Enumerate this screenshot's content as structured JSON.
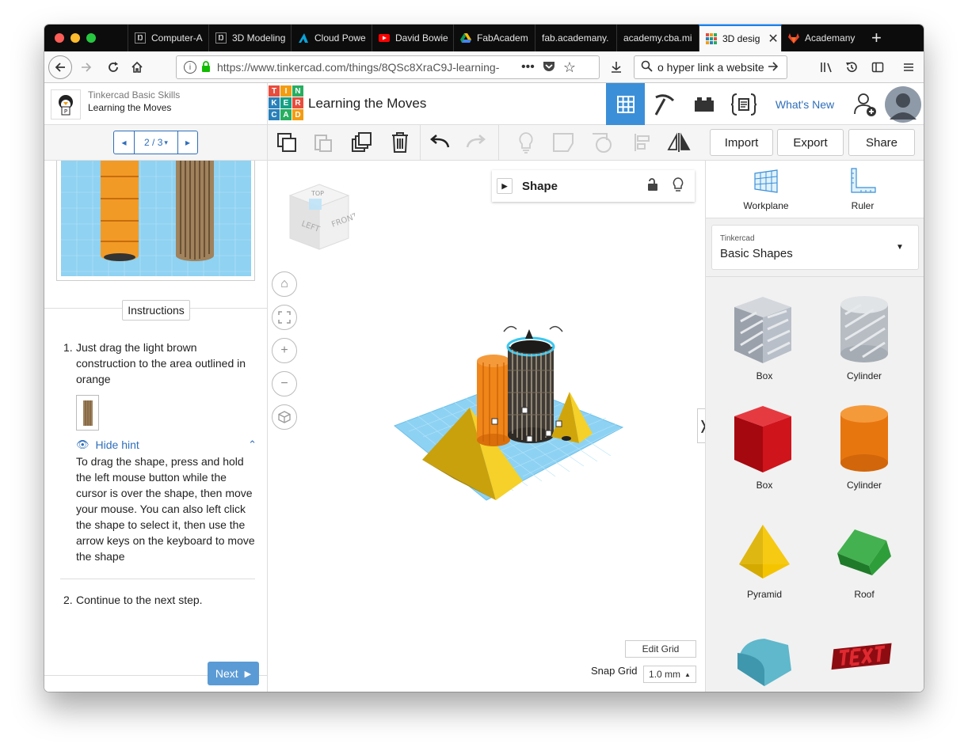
{
  "browser": {
    "tabs": [
      {
        "label": "Computer-A",
        "icon": "academany-icon"
      },
      {
        "label": "3D Modeling",
        "icon": "academany-icon"
      },
      {
        "label": "Cloud Powe",
        "icon": "autodesk-icon"
      },
      {
        "label": "David Bowie",
        "icon": "youtube-icon"
      },
      {
        "label": "FabAcadem",
        "icon": "google-drive-icon"
      },
      {
        "label": "fab.academany.",
        "icon": ""
      },
      {
        "label": "academy.cba.mi",
        "icon": ""
      },
      {
        "label": "3D desig",
        "icon": "tinkercad-icon"
      },
      {
        "label": "Academany",
        "icon": "gitlab-icon"
      }
    ],
    "url": "https://www.tinkercad.com/things/8QSc8XraC9J-learning-",
    "search_value": "o hyper link a website"
  },
  "lesson": {
    "course": "Tinkercad Basic Skills",
    "title": "Learning the Moves",
    "page": "2 / 3",
    "instructions_label": "Instructions",
    "step1": "Just drag the light brown construction to the area outlined in orange",
    "hint_toggle": "Hide hint",
    "hint": "To drag the shape, press and hold the left mouse button while the cursor is over the shape, then move your mouse. You can also left click the shape to select it, then use the arrow keys on the keyboard to move the shape",
    "step2": "Continue to the next step.",
    "next_label": "Next"
  },
  "app": {
    "logo_letters": [
      "T",
      "I",
      "N",
      "K",
      "E",
      "R",
      "C",
      "A",
      "D"
    ],
    "design_title": "Learning the Moves",
    "whats_new": "What's New",
    "import_label": "Import",
    "export_label": "Export",
    "share_label": "Share"
  },
  "canvas": {
    "shape_panel_title": "Shape",
    "edit_grid": "Edit Grid",
    "snap_grid_label": "Snap Grid",
    "snap_grid_value": "1.0 mm",
    "cube_labels": {
      "top": "TOP",
      "left": "LEFT",
      "front": "FRONT"
    }
  },
  "library": {
    "workplane_label": "Workplane",
    "ruler_label": "Ruler",
    "provider": "Tinkercad",
    "category": "Basic Shapes",
    "shapes": [
      {
        "label": "Box",
        "color": "#b8bfc8"
      },
      {
        "label": "Cylinder",
        "color": "#c0c4cb"
      },
      {
        "label": "Box",
        "color": "#d0141c"
      },
      {
        "label": "Cylinder",
        "color": "#e8760f"
      },
      {
        "label": "Pyramid",
        "color": "#f5c400"
      },
      {
        "label": "Roof",
        "color": "#2e9e3a"
      },
      {
        "label": "",
        "color": "#5fb8cc"
      },
      {
        "label": "",
        "color": "#c8151c"
      }
    ]
  },
  "colors": {
    "accent": "#2f6fba",
    "grid": "#6fc1ea",
    "orange_outline": "#e8760f"
  }
}
